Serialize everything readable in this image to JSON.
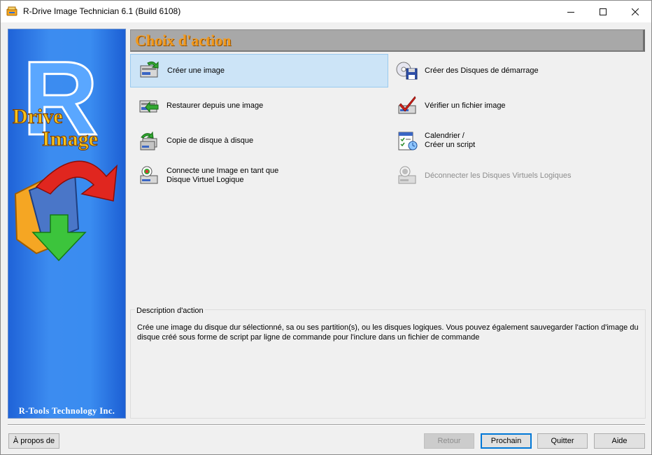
{
  "window": {
    "title": "R-Drive Image Technician 6.1 (Build 6108)"
  },
  "banner": {
    "footer": "R-Tools Technology Inc.",
    "logo_word1": "Drive",
    "logo_word2": "Image",
    "logo_letter": "R"
  },
  "header": {
    "title": "Choix d'action"
  },
  "actions": {
    "create_image": {
      "label": "Créer une image",
      "icon": "create-image-icon"
    },
    "restore": {
      "label": "Restaurer depuis une image",
      "icon": "restore-image-icon"
    },
    "copy_disk": {
      "label": "Copie de disque à disque",
      "icon": "disk-copy-icon"
    },
    "connect_line1": "Connecte une Image en tant que",
    "connect_line2": "Disque Virtuel Logique",
    "startup_disks": {
      "label": "Créer des Disques de démarrage",
      "icon": "startup-disk-icon"
    },
    "verify": {
      "label": "Vérifier un fichier image",
      "icon": "verify-icon"
    },
    "schedule_line1": "Calendrier /",
    "schedule_line2": "Créer un script",
    "disconnect": {
      "label": "Déconnecter les Disques Virtuels Logiques",
      "icon": "disconnect-icon"
    }
  },
  "description": {
    "legend": "Description d'action",
    "text": "Crée une image du disque dur sélectionné, sa ou ses partition(s), ou les disques logiques. Vous pouvez également sauvegarder l'action d'image du disque créé sous forme de script par ligne de commande pour l'inclure dans un fichier de commande"
  },
  "buttons": {
    "about": "À propos de",
    "back": "Retour",
    "next": "Prochain",
    "quit": "Quitter",
    "help": "Aide"
  },
  "colors": {
    "selection": "#cce4f7",
    "header_text": "#f29a1e",
    "banner_blue": "#3a8cf0",
    "default_button_border": "#0078d7"
  }
}
